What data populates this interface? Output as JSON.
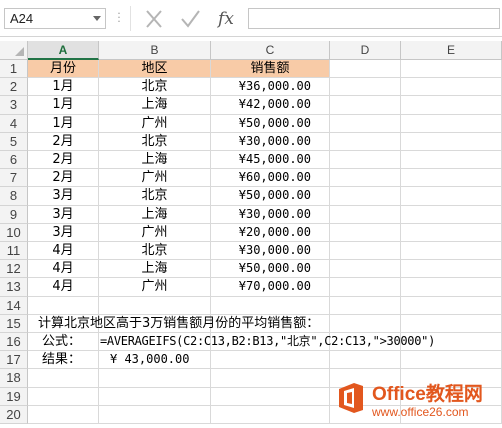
{
  "formula_bar": {
    "name_box": "A24",
    "fx_label": "fx",
    "formula": ""
  },
  "columns": [
    "A",
    "B",
    "C",
    "D",
    "E"
  ],
  "selected_column": "A",
  "rows": [
    "1",
    "2",
    "3",
    "4",
    "5",
    "6",
    "7",
    "8",
    "9",
    "10",
    "11",
    "12",
    "13",
    "14",
    "15",
    "16",
    "17",
    "18",
    "19",
    "20"
  ],
  "table": {
    "header": {
      "month": "月份",
      "region": "地区",
      "sales": "销售额"
    },
    "rows": [
      {
        "month": "1月",
        "region": "北京",
        "sales": "¥36,000.00"
      },
      {
        "month": "1月",
        "region": "上海",
        "sales": "¥42,000.00"
      },
      {
        "month": "1月",
        "region": "广州",
        "sales": "¥50,000.00"
      },
      {
        "month": "2月",
        "region": "北京",
        "sales": "¥30,000.00"
      },
      {
        "month": "2月",
        "region": "上海",
        "sales": "¥45,000.00"
      },
      {
        "month": "2月",
        "region": "广州",
        "sales": "¥60,000.00"
      },
      {
        "month": "3月",
        "region": "北京",
        "sales": "¥50,000.00"
      },
      {
        "month": "3月",
        "region": "上海",
        "sales": "¥30,000.00"
      },
      {
        "month": "3月",
        "region": "广州",
        "sales": "¥20,000.00"
      },
      {
        "month": "4月",
        "region": "北京",
        "sales": "¥30,000.00"
      },
      {
        "month": "4月",
        "region": "上海",
        "sales": "¥50,000.00"
      },
      {
        "month": "4月",
        "region": "广州",
        "sales": "¥70,000.00"
      }
    ]
  },
  "notes": {
    "question": "计算北京地区高于3万销售额月份的平均销售额：",
    "formula_label": "公式：",
    "formula_text": "=AVERAGEIFS(C2:C13,B2:B13,\"北京\",C2:C13,\">30000\")",
    "result_label": "结果：",
    "result_value": "¥ 43,000.00"
  },
  "watermark": {
    "title": "Office教程网",
    "url": "www.office26.com"
  },
  "colors": {
    "header_fill": "#f8cba7",
    "selected_accent": "#217346",
    "watermark": "#e2571e"
  },
  "icons": [
    "cancel-icon",
    "enter-icon",
    "fx-icon",
    "dropdown-arrow-icon",
    "office-logo-icon"
  ]
}
